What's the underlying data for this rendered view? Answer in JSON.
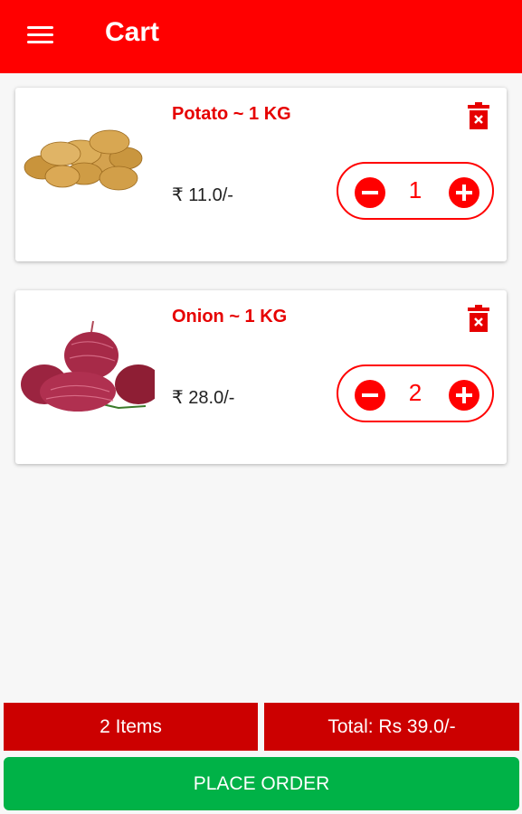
{
  "app_bar": {
    "title": "Cart",
    "menu_icon": "menu-icon",
    "color": "#ff0000"
  },
  "cart_items": [
    {
      "name": "Potato ~ 1 KG",
      "price": "₹ 11.0/-",
      "quantity": "1",
      "image": "potato-image"
    },
    {
      "name": "Onion ~ 1 KG",
      "price": "₹ 28.0/-",
      "quantity": "2",
      "image": "onion-image"
    }
  ],
  "summary": {
    "items_count": "2 Items",
    "total": "Total: Rs 39.0/-",
    "color": "#cc0000"
  },
  "place_order": {
    "label": "PLACE ORDER",
    "color": "#00b247"
  },
  "icons": {
    "delete": "delete-icon",
    "decrement": "minus-circle-icon",
    "increment": "plus-circle-icon"
  }
}
